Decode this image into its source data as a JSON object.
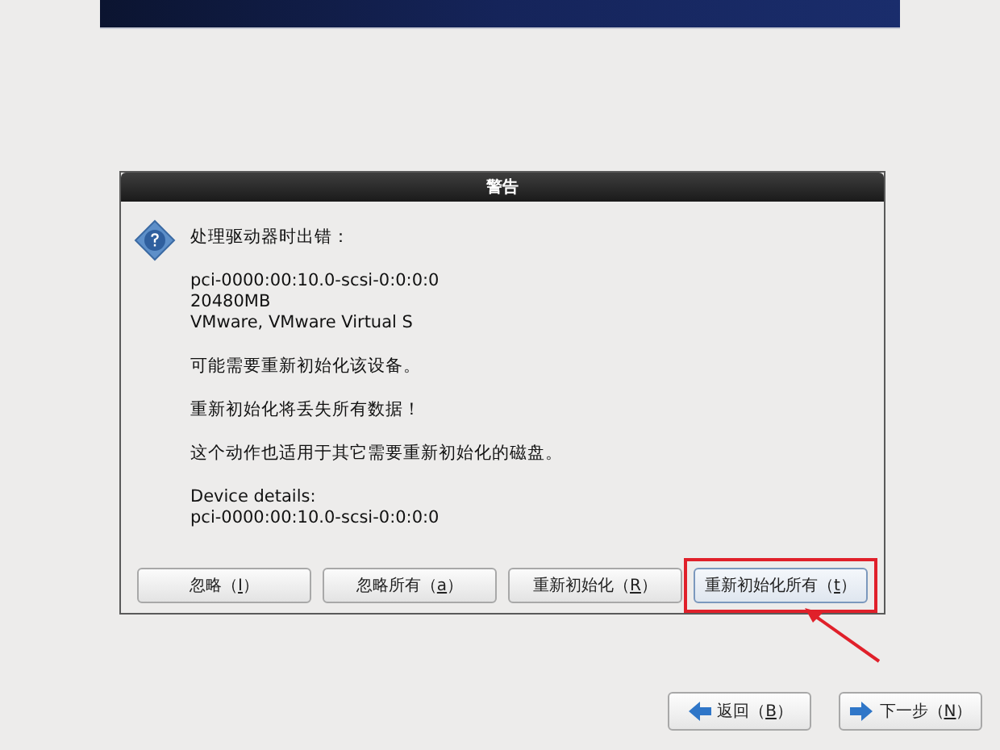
{
  "dialog": {
    "title": "警告",
    "paragraphs": [
      [
        "处理驱动器时出错："
      ],
      [
        "pci-0000:00:10.0-scsi-0:0:0:0",
        "20480MB",
        "VMware, VMware Virtual S"
      ],
      [
        "可能需要重新初始化该设备。"
      ],
      [
        "重新初始化将丢失所有数据！"
      ],
      [
        "这个动作也适用于其它需要重新初始化的磁盘。"
      ],
      [
        "Device details:",
        "pci-0000:00:10.0-scsi-0:0:0:0"
      ]
    ],
    "buttons": [
      {
        "before": "忽略（",
        "mnemonic": "I",
        "after": "）",
        "focused": false,
        "highlighted": false
      },
      {
        "before": "忽略所有（",
        "mnemonic": "a",
        "after": "）",
        "focused": false,
        "highlighted": false
      },
      {
        "before": "重新初始化（",
        "mnemonic": "R",
        "after": "）",
        "focused": false,
        "highlighted": false
      },
      {
        "before": "重新初始化所有（",
        "mnemonic": "t",
        "after": "）",
        "focused": true,
        "highlighted": true
      }
    ]
  },
  "navigation": [
    {
      "kind": "back",
      "before": "返回（",
      "mnemonic": "B",
      "after": "）"
    },
    {
      "kind": "next",
      "before": "下一步（",
      "mnemonic": "N",
      "after": "）"
    }
  ]
}
